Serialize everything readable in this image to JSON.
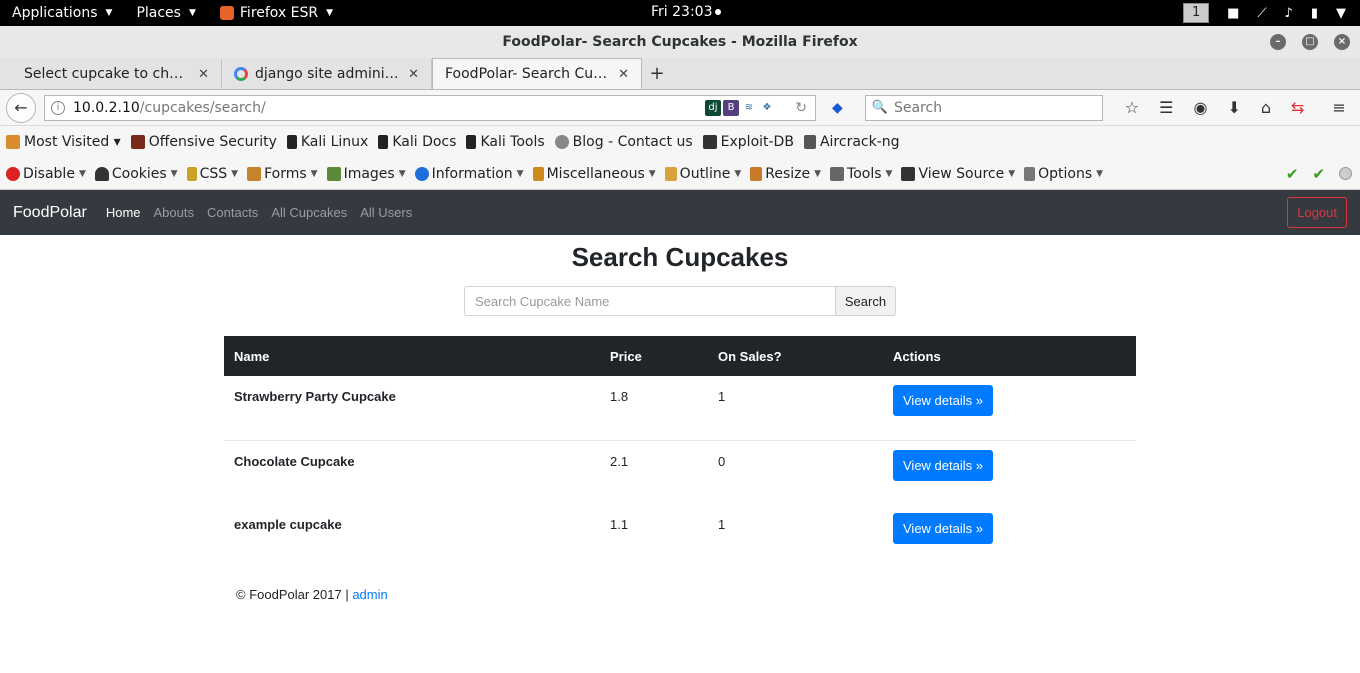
{
  "system_bar": {
    "applications": "Applications",
    "places": "Places",
    "firefox": "Firefox ESR",
    "clock": "Fri 23:03",
    "workspace": "1"
  },
  "window": {
    "title": "FoodPolar- Search Cupcakes - Mozilla Firefox"
  },
  "tabs": [
    {
      "label": "Select cupcake to chang..."
    },
    {
      "label": "django site administra..."
    },
    {
      "label": "FoodPolar- Search Cupca..."
    }
  ],
  "url": {
    "host": "10.0.2.10",
    "path": "/cupcakes/search/"
  },
  "search_placeholder": "Search",
  "bookmarks": [
    {
      "label": "Most Visited ▾"
    },
    {
      "label": "Offensive Security"
    },
    {
      "label": "Kali Linux"
    },
    {
      "label": "Kali Docs"
    },
    {
      "label": "Kali Tools"
    },
    {
      "label": "Blog - Contact us"
    },
    {
      "label": "Exploit-DB"
    },
    {
      "label": "Aircrack-ng"
    }
  ],
  "devtools": [
    {
      "label": "Disable"
    },
    {
      "label": "Cookies"
    },
    {
      "label": "CSS"
    },
    {
      "label": "Forms"
    },
    {
      "label": "Images"
    },
    {
      "label": "Information"
    },
    {
      "label": "Miscellaneous"
    },
    {
      "label": "Outline"
    },
    {
      "label": "Resize"
    },
    {
      "label": "Tools"
    },
    {
      "label": "View Source"
    },
    {
      "label": "Options"
    }
  ],
  "site": {
    "brand": "FoodPolar",
    "nav": [
      "Home",
      "Abouts",
      "Contacts",
      "All Cupcakes",
      "All Users"
    ],
    "logout": "Logout"
  },
  "page": {
    "title": "Search Cupcakes",
    "search_placeholder": "Search Cupcake Name",
    "search_button": "Search"
  },
  "table": {
    "headers": [
      "Name",
      "Price",
      "On Sales?",
      "Actions"
    ],
    "rows": [
      {
        "name": "Strawberry Party Cupcake",
        "price": "1.8",
        "on_sale": "1",
        "action": "View details »"
      },
      {
        "name": "Chocolate Cupcake",
        "price": "2.1",
        "on_sale": "0",
        "action": "View details »"
      },
      {
        "name": "example cupcake",
        "price": "1.1",
        "on_sale": "1",
        "action": "View details »"
      }
    ]
  },
  "footer": {
    "text": "© FoodPolar 2017 |",
    "link": "admin"
  }
}
